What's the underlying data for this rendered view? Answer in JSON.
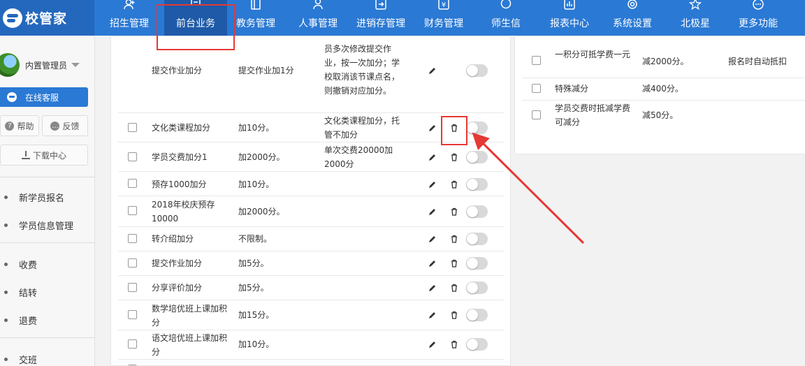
{
  "app": {
    "logo_text": "校管家"
  },
  "nav": {
    "items": [
      {
        "label": "招生管理",
        "icon": "user-plus-icon"
      },
      {
        "label": "前台业务",
        "icon": "monitor-icon"
      },
      {
        "label": "教务管理",
        "icon": "book-icon"
      },
      {
        "label": "人事管理",
        "icon": "person-icon"
      },
      {
        "label": "进销存管理",
        "icon": "inventory-icon"
      },
      {
        "label": "财务管理",
        "icon": "yen-icon"
      },
      {
        "label": "师生信",
        "icon": "chat-icon"
      },
      {
        "label": "报表中心",
        "icon": "chart-icon"
      },
      {
        "label": "系统设置",
        "icon": "gear-icon"
      },
      {
        "label": "北极星",
        "icon": "star-icon"
      },
      {
        "label": "更多功能",
        "icon": "more-icon"
      }
    ],
    "active_index": 1
  },
  "sidebar": {
    "user_name": "内置管理员",
    "service_label": "在线客服",
    "help_label": "帮助",
    "feedback_label": "反馈",
    "download_label": "下载中心",
    "menu": [
      "新学员报名",
      "学员信息管理",
      "收费",
      "结转",
      "退费",
      "交班"
    ]
  },
  "points_table": {
    "rows": [
      {
        "name": "提交作业加分",
        "rule": "提交作业加1分",
        "desc": "员多次修改提交作业，按一次加分；学校取消该节课点名，则撤销对应加分。"
      },
      {
        "name": "文化类课程加分",
        "rule": "加10分。",
        "desc": "文化类课程加分，托管不加分"
      },
      {
        "name": "学员交费加分1",
        "rule": "加2000分。",
        "desc": "单次交费20000加2000分"
      },
      {
        "name": "预存1000加分",
        "rule": "加10分。",
        "desc": ""
      },
      {
        "name": "2018年校庆预存10000",
        "rule": "加2000分。",
        "desc": ""
      },
      {
        "name": "转介绍加分",
        "rule": "不限制。",
        "desc": ""
      },
      {
        "name": "提交作业加分",
        "rule": "加5分。",
        "desc": ""
      },
      {
        "name": "分享评价加分",
        "rule": "加5分。",
        "desc": ""
      },
      {
        "name": "数学培优班上课加积分",
        "rule": "加15分。",
        "desc": ""
      },
      {
        "name": "语文培优班上课加积分",
        "rule": "加10分。",
        "desc": ""
      }
    ]
  },
  "deduct_table": {
    "rows": [
      {
        "name": "一积分可抵学费一元",
        "rule": "减2000分。",
        "note": "报名时自动抵扣"
      },
      {
        "name": "特殊减分",
        "rule": "减400分。",
        "note": ""
      },
      {
        "name": "学员交费时抵减学费可减分",
        "rule": "减50分。",
        "note": ""
      }
    ]
  },
  "colors": {
    "nav_bg": "#2a79d4",
    "logo_bg": "#2468bd",
    "active_nav": "#1e5aa8",
    "annotation": "#e53935"
  }
}
